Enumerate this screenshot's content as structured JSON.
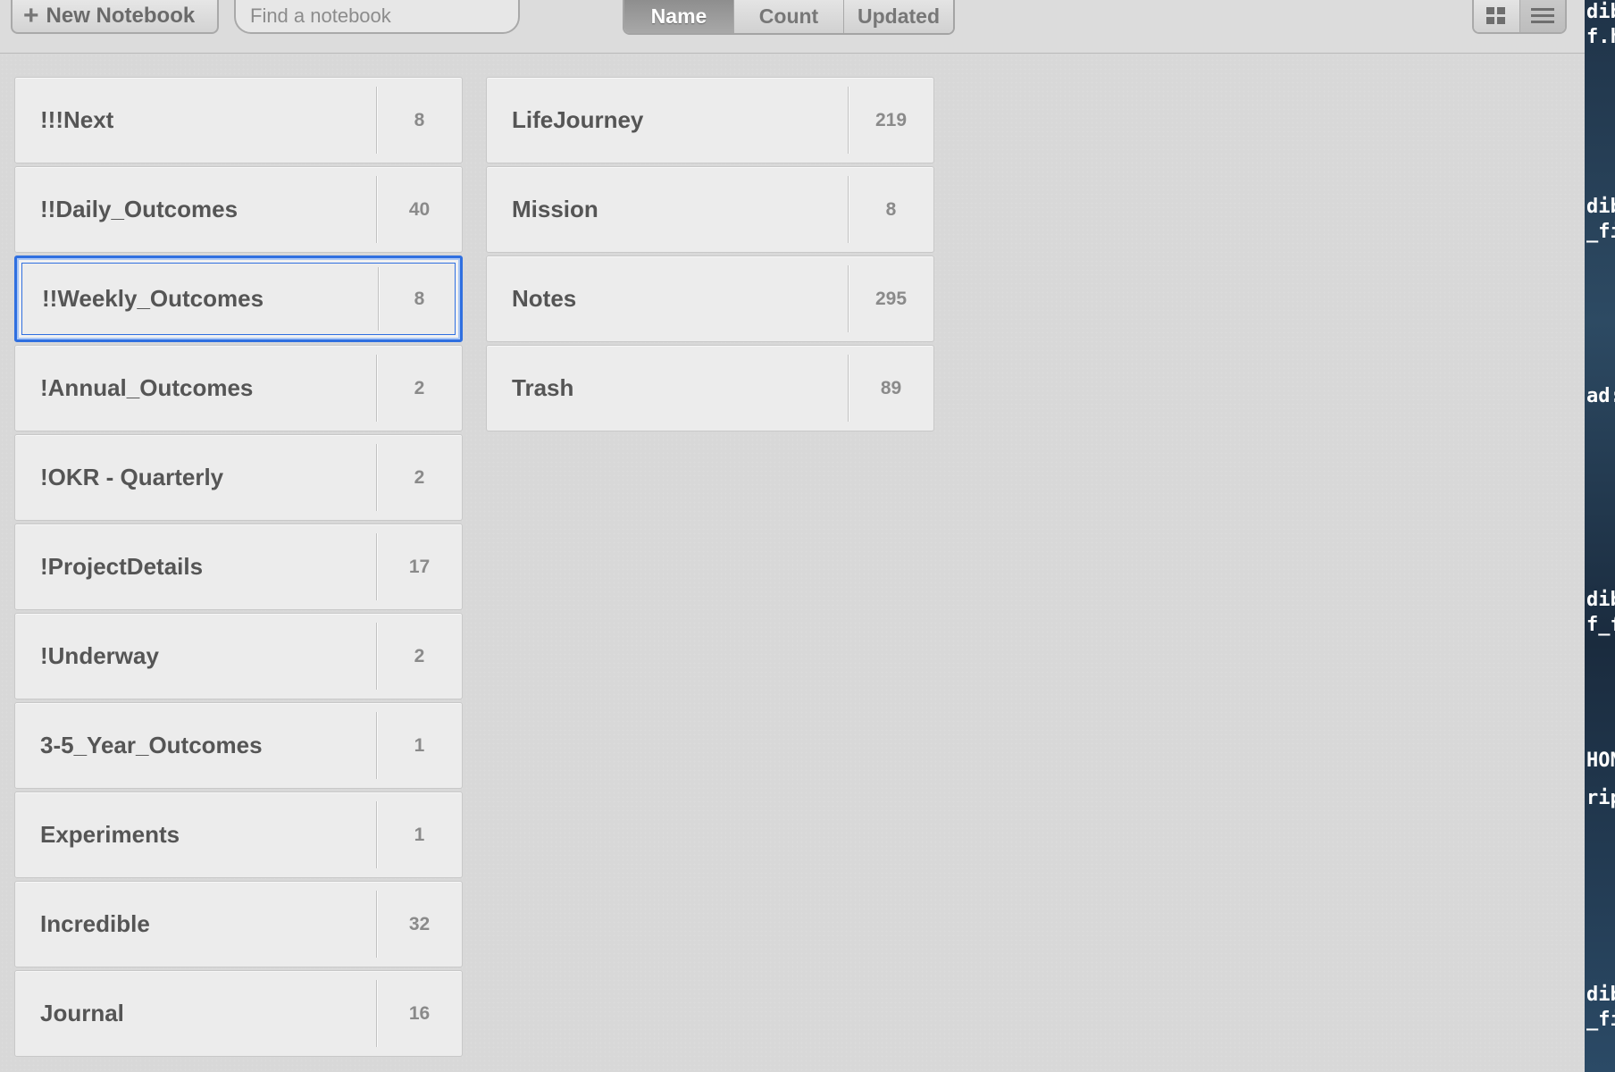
{
  "toolbar": {
    "new_notebook_label": "New Notebook",
    "search_placeholder": "Find a notebook",
    "sort_options": [
      "Name",
      "Count",
      "Updated"
    ],
    "active_sort": "Name"
  },
  "notebooks_left": [
    {
      "name": "!!!Next",
      "count": "8"
    },
    {
      "name": "!!Daily_Outcomes",
      "count": "40"
    },
    {
      "name": "!!Weekly_Outcomes",
      "count": "8",
      "selected": true
    },
    {
      "name": "!Annual_Outcomes",
      "count": "2"
    },
    {
      "name": "!OKR - Quarterly",
      "count": "2"
    },
    {
      "name": "!ProjectDetails",
      "count": "17"
    },
    {
      "name": "!Underway",
      "count": "2"
    },
    {
      "name": "3-5_Year_Outcomes",
      "count": "1"
    },
    {
      "name": "Experiments",
      "count": "1"
    },
    {
      "name": "Incredible",
      "count": "32"
    },
    {
      "name": "Journal",
      "count": "16"
    }
  ],
  "notebooks_right": [
    {
      "name": "LifeJourney",
      "count": "219"
    },
    {
      "name": "Mission",
      "count": "8"
    },
    {
      "name": "Notes",
      "count": "295"
    },
    {
      "name": "Trash",
      "count": "89"
    }
  ],
  "desktop_labels": [
    "dib",
    "f.h",
    "dib",
    "_fi",
    "ad:",
    "dib",
    "f_fi",
    "HON",
    "ript",
    "dib",
    "_fil"
  ],
  "colors": {
    "selection": "#2f6fe0",
    "active_sort_bg": "#999999"
  }
}
